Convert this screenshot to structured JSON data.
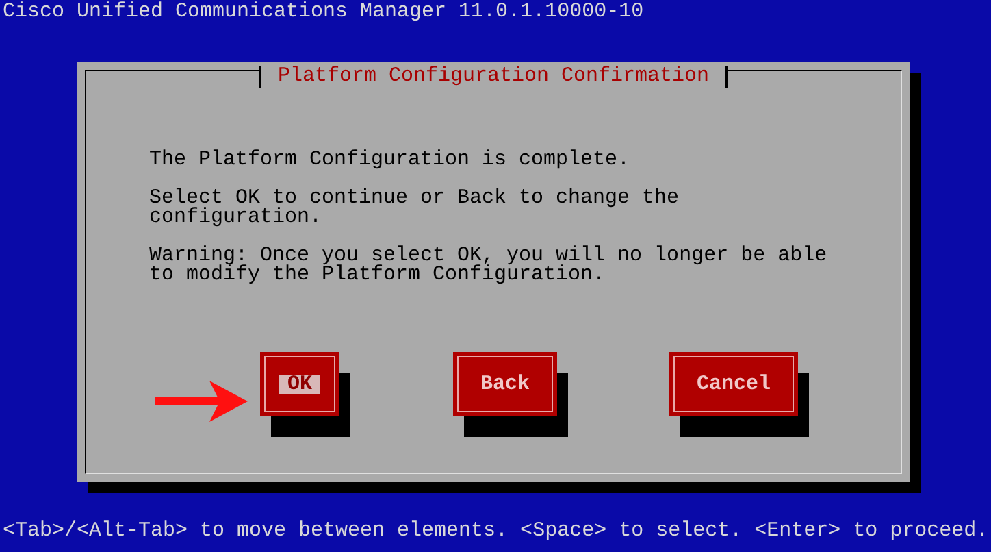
{
  "window": {
    "title": "Cisco Unified Communications Manager 11.0.1.10000-10"
  },
  "dialog": {
    "title": "Platform Configuration Confirmation",
    "paragraphs": [
      "The Platform Configuration is complete.",
      "Select OK to continue or Back to change the configuration.",
      "Warning: Once you select OK, you will no longer be able to modify the Platform Configuration."
    ],
    "buttons": [
      {
        "label": "OK",
        "selected": true
      },
      {
        "label": "Back",
        "selected": false
      },
      {
        "label": "Cancel",
        "selected": false
      }
    ]
  },
  "status_bar": {
    "hint": "<Tab>/<Alt-Tab> to move between elements. <Space> to select. <Enter> to proceed."
  }
}
